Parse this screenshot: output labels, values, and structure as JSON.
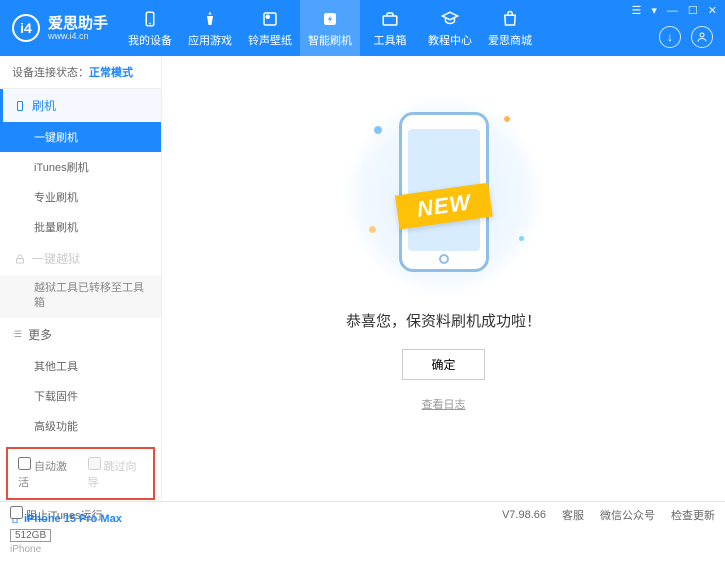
{
  "app": {
    "name": "爱思助手",
    "url": "www.i4.cn"
  },
  "nav": [
    {
      "label": "我的设备"
    },
    {
      "label": "应用游戏"
    },
    {
      "label": "铃声壁纸"
    },
    {
      "label": "智能刷机",
      "active": true
    },
    {
      "label": "工具箱"
    },
    {
      "label": "教程中心"
    },
    {
      "label": "爱思商城"
    }
  ],
  "status": {
    "prefix": "设备连接状态：",
    "mode": "正常模式"
  },
  "sidebar": {
    "flash_header": "刷机",
    "flash_items": [
      "一键刷机",
      "iTunes刷机",
      "专业刷机",
      "批量刷机"
    ],
    "jailbreak_header": "一键越狱",
    "jailbreak_note": "越狱工具已转移至工具箱",
    "more_header": "更多",
    "more_items": [
      "其他工具",
      "下载固件",
      "高级功能"
    ]
  },
  "checks": {
    "auto_activate": "自动激活",
    "skip_guide": "跳过向导"
  },
  "device": {
    "name": "iPhone 15 Pro Max",
    "storage": "512GB",
    "type": "iPhone"
  },
  "main": {
    "banner": "NEW",
    "success": "恭喜您，保资料刷机成功啦！",
    "ok": "确定",
    "log": "查看日志"
  },
  "footer": {
    "block_itunes": "阻止iTunes运行",
    "version": "V7.98.66",
    "links": [
      "客服",
      "微信公众号",
      "检查更新"
    ]
  }
}
